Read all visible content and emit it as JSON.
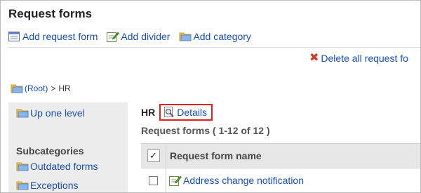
{
  "page": {
    "title": "Request forms"
  },
  "toolbar": {
    "items": [
      {
        "label": "Add request form",
        "icon": "form-icon"
      },
      {
        "label": "Add divider",
        "icon": "edit-icon"
      },
      {
        "label": "Add category",
        "icon": "folder-icon"
      }
    ],
    "delete_all_label": "Delete all request fo"
  },
  "breadcrumb": {
    "root": "(Root)",
    "separator": ">",
    "current": "HR"
  },
  "sidebar": {
    "up_one_level": "Up one level",
    "subcategories_heading": "Subcategories",
    "subcategories": [
      "Outdated forms",
      "Exceptions"
    ]
  },
  "category": {
    "name": "HR",
    "details_label": "Details"
  },
  "list": {
    "count_text": "Request forms ( 1-12 of 12 )",
    "header_check": "✓",
    "column_name": "Request form name",
    "rows": [
      {
        "name": "Address change notification"
      }
    ]
  },
  "colors": {
    "link": "#1a4fa8",
    "highlight_border": "#e02020",
    "delete_icon": "#d23b2b",
    "sidebar_bg": "#ececec",
    "table_header_bg": "#e6e6e6"
  }
}
